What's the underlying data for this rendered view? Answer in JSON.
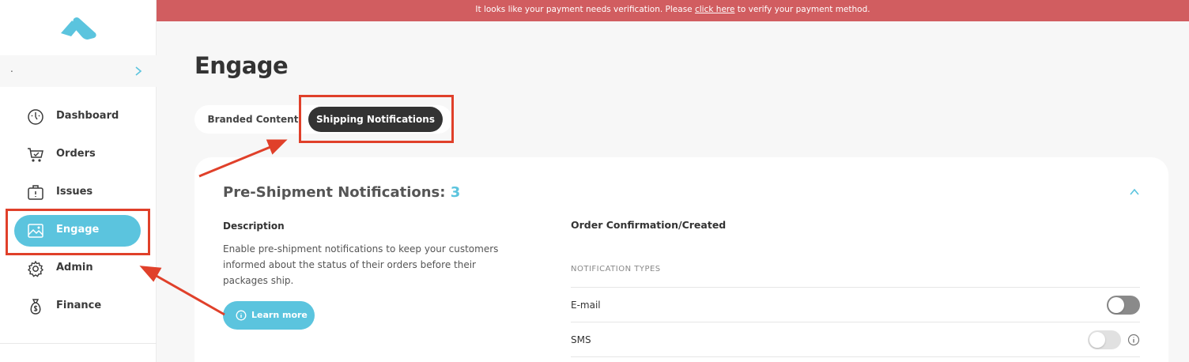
{
  "banner": {
    "text_before": "It looks like your payment needs verification. Please ",
    "link": "click here",
    "text_after": " to verify your payment method."
  },
  "sidebar": {
    "account_name": ".",
    "items": [
      {
        "label": "Dashboard",
        "icon": "dashboard-gauge-icon"
      },
      {
        "label": "Orders",
        "icon": "cart-icon"
      },
      {
        "label": "Issues",
        "icon": "issues-icon"
      },
      {
        "label": "Engage",
        "icon": "image-icon",
        "active": true
      },
      {
        "label": "Admin",
        "icon": "gear-icon"
      },
      {
        "label": "Finance",
        "icon": "money-bag-icon"
      }
    ]
  },
  "page": {
    "title": "Engage"
  },
  "tabs": [
    {
      "label": "Branded Content",
      "active": false
    },
    {
      "label": "Shipping Notifications",
      "active": true
    }
  ],
  "card": {
    "title": "Pre-Shipment Notifications:",
    "count": "3",
    "description_heading": "Description",
    "description": "Enable pre-shipment notifications to keep your customers informed about the status of their orders before their packages ship.",
    "learn_more": "Learn more",
    "section_heading": "Order Confirmation/Created",
    "types_label": "NOTIFICATION TYPES",
    "types": [
      {
        "label": "E-mail",
        "enabled": false
      },
      {
        "label": "SMS",
        "enabled": false
      }
    ]
  },
  "colors": {
    "accent": "#5bc4de",
    "banner": "#d15d60",
    "annotation": "#e0402a",
    "dark_tab": "#333333"
  }
}
